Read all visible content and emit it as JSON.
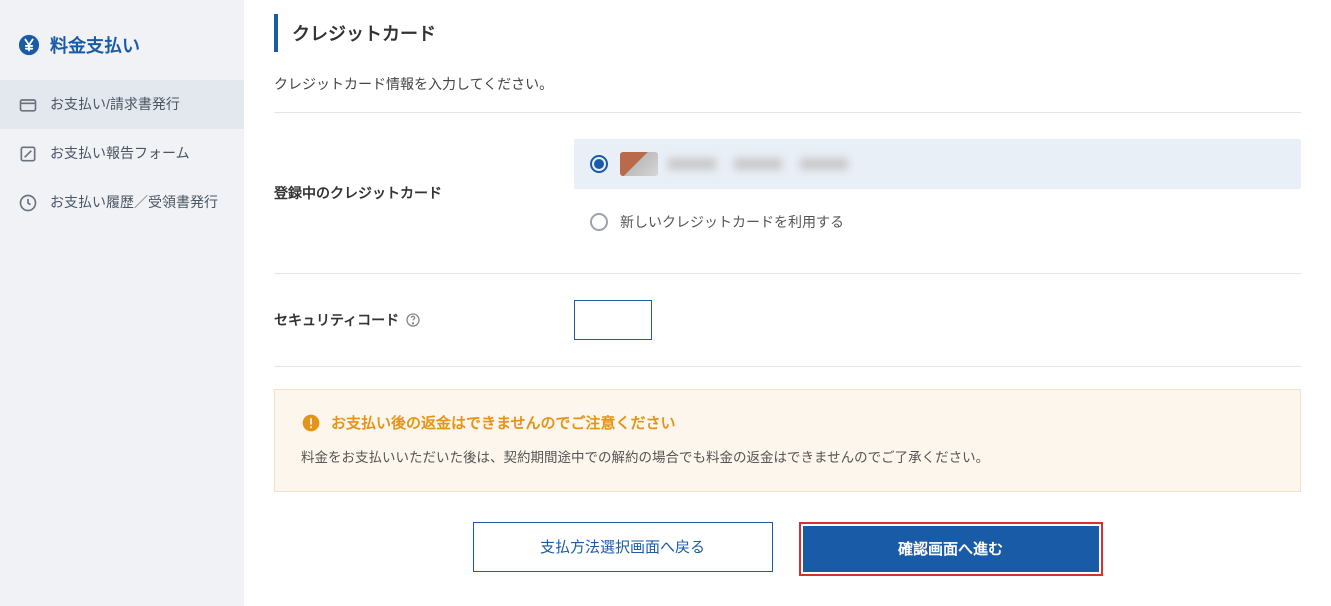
{
  "sidebar": {
    "title": "料金支払い",
    "items": [
      {
        "label": "お支払い/請求書発行",
        "active": true
      },
      {
        "label": "お支払い報告フォーム",
        "active": false
      },
      {
        "label": "お支払い履歴／受領書発行",
        "active": false
      }
    ]
  },
  "section": {
    "title": "クレジットカード",
    "instruction": "クレジットカード情報を入力してください。"
  },
  "card": {
    "label": "登録中のクレジットカード",
    "option_new": "新しいクレジットカードを利用する"
  },
  "security": {
    "label": "セキュリティコード",
    "placeholder": ""
  },
  "warning": {
    "title": "お支払い後の返金はできませんのでご注意ください",
    "text": "料金をお支払いいただいた後は、契約期間途中での解約の場合でも料金の返金はできませんのでご了承ください。"
  },
  "buttons": {
    "back": "支払方法選択画面へ戻る",
    "next": "確認画面へ進む"
  }
}
